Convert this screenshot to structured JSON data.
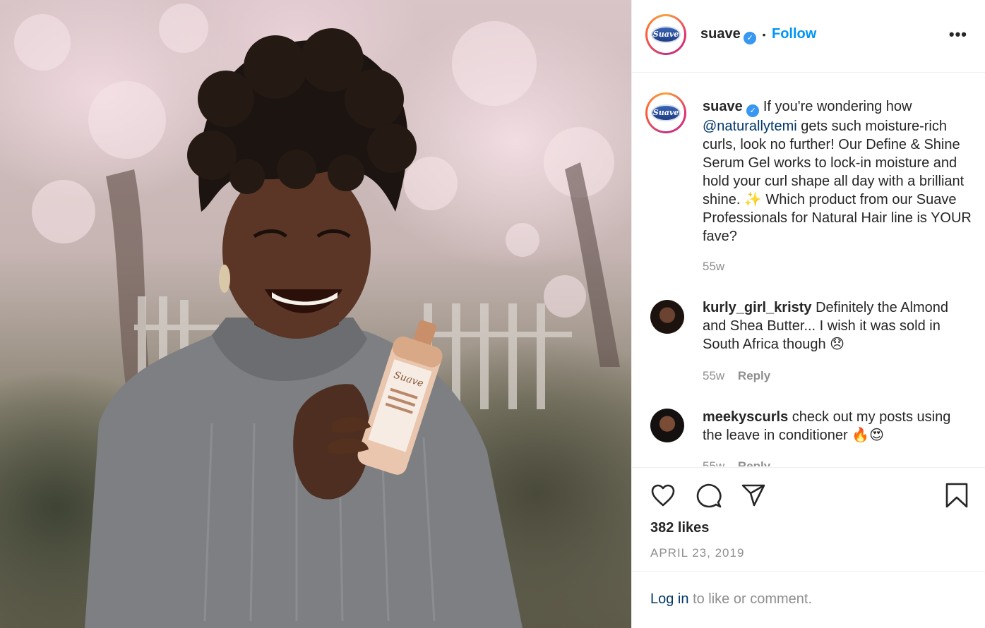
{
  "header": {
    "username": "suave",
    "separator": "•",
    "follow_label": "Follow",
    "more_label": "•••",
    "avatar_text": "Suave"
  },
  "caption": {
    "username": "suave",
    "text_before_mention": "If you're wondering how",
    "mention": "@naturallytemi",
    "text_after_mention": "gets such moisture-rich curls, look no further! Our Define & Shine Serum Gel works to lock-in moisture and hold your curl shape all day with a brilliant shine. ✨ Which product from our Suave Professionals for Natural Hair line is YOUR fave?",
    "time": "55w"
  },
  "comments": [
    {
      "username": "kurly_girl_kristy",
      "text": "Definitely the Almond and Shea Butter... I wish it was sold in South Africa though 😞",
      "time": "55w",
      "reply_label": "Reply"
    },
    {
      "username": "meekyscurls",
      "text": "check out my posts using the leave in conditioner 🔥😍",
      "time": "55w",
      "reply_label": "Reply"
    }
  ],
  "engagement": {
    "likes": "382 likes",
    "date": "APRIL 23, 2019"
  },
  "login_prompt": {
    "link": "Log in",
    "text": "to like or comment."
  },
  "icons": {
    "like": "heart-icon",
    "comment": "comment-bubble-icon",
    "share": "paper-plane-icon",
    "save": "bookmark-icon",
    "verified": "verified-badge-icon"
  },
  "colors": {
    "accent": "#0095f6",
    "verified": "#3897f0",
    "muted": "#8e8e8e",
    "mention": "#00376b"
  }
}
